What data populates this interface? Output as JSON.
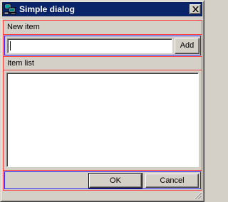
{
  "window": {
    "title": "Simple dialog",
    "close_symbol": "close-icon",
    "app_icon": "computers-icon"
  },
  "new_item": {
    "group_label": "New item",
    "input_value": "",
    "add_label": "Add"
  },
  "item_list": {
    "group_label": "Item list",
    "items": []
  },
  "footer": {
    "ok_label": "OK",
    "cancel_label": "Cancel"
  },
  "colors": {
    "titlebar": "#0a246a",
    "face": "#d4d0c8",
    "debug_outer": "#ff4040",
    "debug_inner": "#2020ff"
  }
}
